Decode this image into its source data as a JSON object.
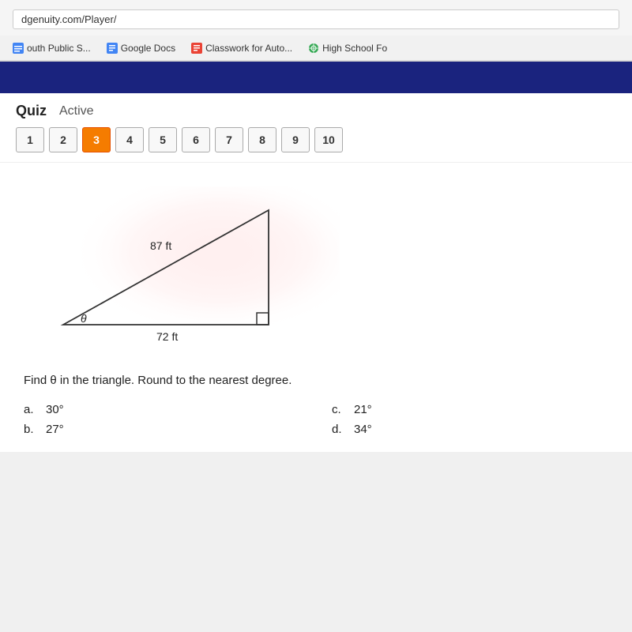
{
  "browser": {
    "address": "dgenuity.com/Player/",
    "bookmarks": [
      {
        "id": "south",
        "label": "outh Public S...",
        "icon": "📄",
        "color": "#4285f4"
      },
      {
        "id": "google-docs",
        "label": "Google Docs",
        "icon": "doc",
        "color": "#4285f4"
      },
      {
        "id": "classwork",
        "label": "Classwork for Auto...",
        "icon": "📋",
        "color": "#ea4335"
      },
      {
        "id": "highschool",
        "label": "High School Fo",
        "icon": "🌐",
        "color": "#34a853"
      }
    ]
  },
  "quiz": {
    "title": "Quiz",
    "status": "Active",
    "questions": [
      {
        "number": "1",
        "active": false
      },
      {
        "number": "2",
        "active": false
      },
      {
        "number": "3",
        "active": true
      },
      {
        "number": "4",
        "active": false
      },
      {
        "number": "5",
        "active": false
      },
      {
        "number": "6",
        "active": false
      },
      {
        "number": "7",
        "active": false
      },
      {
        "number": "8",
        "active": false
      },
      {
        "number": "9",
        "active": false
      },
      {
        "number": "10",
        "active": false
      }
    ],
    "triangle": {
      "hypotenuse_label": "87 ft",
      "base_label": "72 ft",
      "angle_label": "θ"
    },
    "question_text": "Find θ in the triangle. Round to the nearest degree.",
    "answers": [
      {
        "letter": "a.",
        "value": "30°"
      },
      {
        "letter": "c.",
        "value": "21°"
      },
      {
        "letter": "b.",
        "value": "27°"
      },
      {
        "letter": "d.",
        "value": "34°"
      }
    ]
  }
}
